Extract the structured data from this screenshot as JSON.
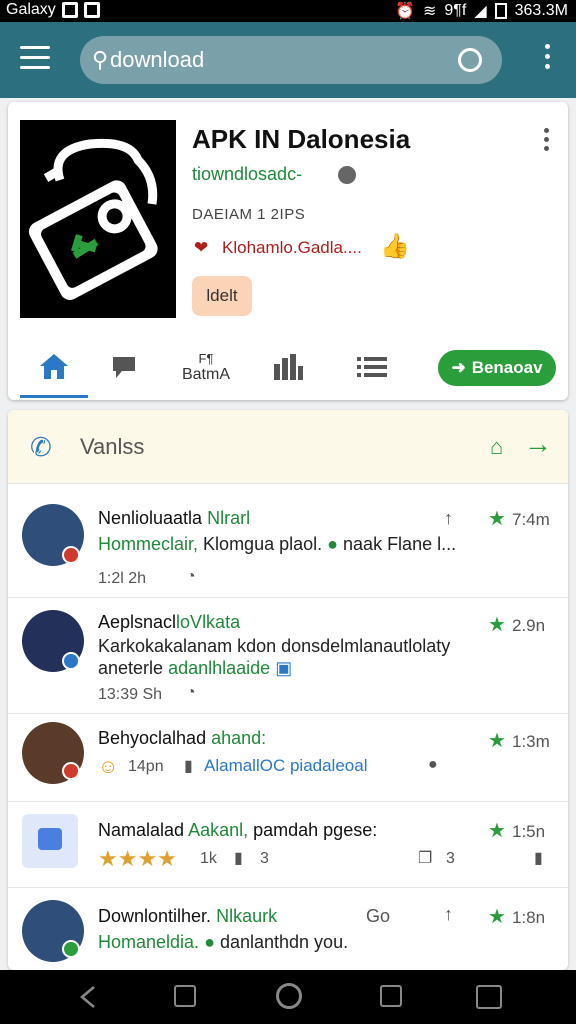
{
  "status_bar": {
    "carrier": "Galaxy",
    "signal": "9¶f",
    "battery": "363.3M"
  },
  "toolbar": {
    "search_value": "download",
    "icons": [
      "menu-icon",
      "search-icon",
      "overflow-icon"
    ]
  },
  "app": {
    "title": "APK IN Dalonesia",
    "developer": "tiowndlosadc-",
    "date": "DAEIAM 1 2IPS",
    "meta": "Klohamlo.Gadla....",
    "tag": "ldelt",
    "icon": "camera-app-icon"
  },
  "tabs": {
    "label_top": "F¶",
    "label_bottom": "BatmA",
    "download_label": "Benaoav",
    "icons": [
      "home-icon",
      "comment-icon",
      "bar-chart-icon",
      "list-icon",
      "download-icon"
    ]
  },
  "section": {
    "title": "Vanlss"
  },
  "rows": [
    {
      "name": "Nenlioluaatla",
      "name_green": "Nlrarl",
      "score": "7:4m",
      "text_green": "Hommeclair,",
      "text": "Klomgua plaol.",
      "text_tail": "naak Flane l...",
      "time": "1:2l 2h",
      "badge_color": "#d33a2c"
    },
    {
      "name": "Aeplsnacl",
      "name_green": "loVlkata",
      "score": "2.9n",
      "text": "Karkokakalanam kdon donsdelmlanautlolaty",
      "text_line2": "aneterle",
      "text_line2_green": "adanlhlaaide",
      "time": "13:39 Sh",
      "badge_color": "#2a78c8"
    },
    {
      "name": "Behyoclalhad",
      "name_green": "ahand:",
      "score": "1:3m",
      "time": "14pn",
      "text_blue": "AlamallOC piadaleoal",
      "badge_color": "#d33a2c"
    },
    {
      "name": "Namalalad",
      "name_green": "Aakanl,",
      "name_tail": "pamdah pgese:",
      "score": "1:5n",
      "time": "1k",
      "likes": "3",
      "copies": "3",
      "stars": "★★★★"
    },
    {
      "name": "Downlontilher.",
      "name_green": "Nlkaurk",
      "name_tail": "Go",
      "score": "1:8n",
      "text_green": "Homaneldia.",
      "text": "danlanthdn you.",
      "badge_color": "#2a9e3a"
    }
  ]
}
